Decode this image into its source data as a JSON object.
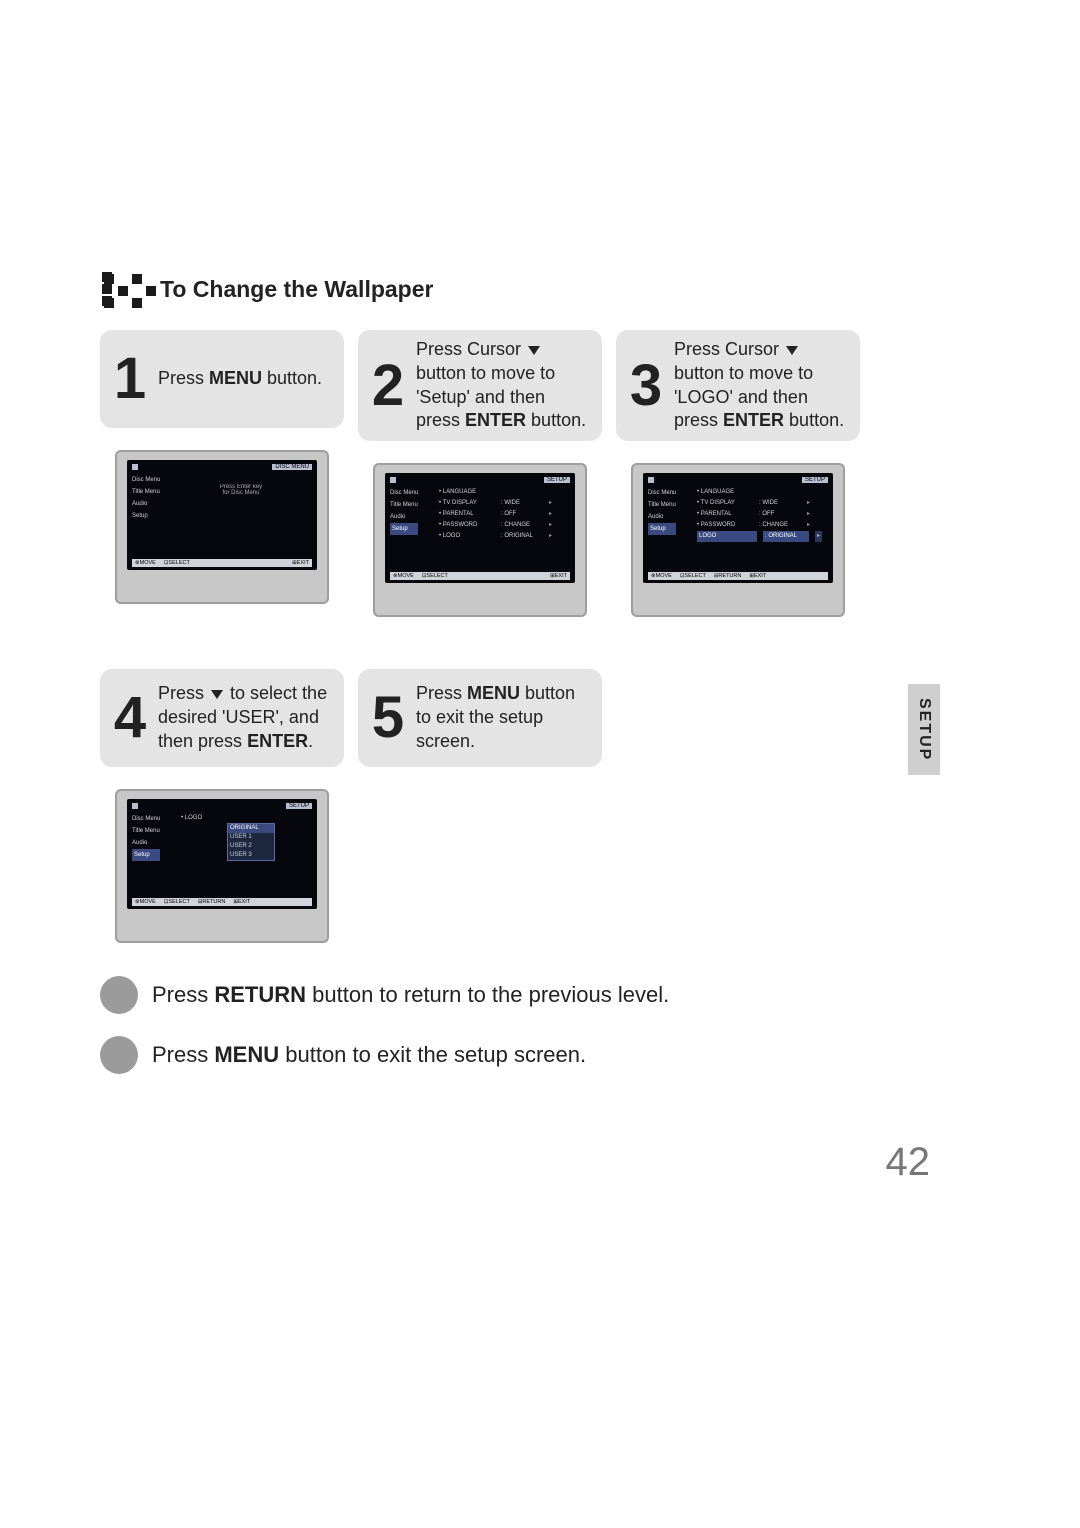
{
  "heading": "To Change the Wallpaper",
  "sideTab": "SETUP",
  "steps": [
    {
      "num": "1",
      "lines": [
        "Press <b>MENU</b> button."
      ]
    },
    {
      "num": "2",
      "lines": [
        "Press Cursor <tri></tri> button to move to 'Setup' and then press <b>ENTER</b> button."
      ]
    },
    {
      "num": "3",
      "lines": [
        "Press Cursor <tri></tri> button to move to 'LOGO' and then press <b>ENTER</b> button."
      ]
    },
    {
      "num": "4",
      "lines": [
        "Press <tri></tri> to select the desired 'USER', and then press <b>ENTER</b>."
      ]
    },
    {
      "num": "5",
      "lines": [
        "Press <b>MENU</b> button to exit the setup screen."
      ]
    }
  ],
  "tv": {
    "sidebar": [
      "Disc Menu",
      "Title Menu",
      "Audio",
      "Setup"
    ],
    "t1": {
      "hdrL": "",
      "hdrR": "DISC MENU",
      "mid1": "Press Enter key",
      "mid2": "for Disc Menu",
      "foot": [
        "⊗MOVE",
        "⊡SELECT",
        "",
        "⊞EXIT"
      ]
    },
    "t2": {
      "hdrL": "",
      "hdrR": "SETUP",
      "rows": [
        [
          "• LANGUAGE",
          "",
          ""
        ],
        [
          "• TV DISPLAY",
          ": WIDE",
          "▸"
        ],
        [
          "• PARENTAL",
          ": OFF",
          "▸"
        ],
        [
          "• PASSWORD",
          ": CHANGE",
          "▸"
        ],
        [
          "• LOGO",
          ": ORIGINAL",
          "▸"
        ]
      ],
      "foot": [
        "⊗MOVE",
        "⊡SELECT",
        "",
        "⊞EXIT"
      ]
    },
    "t3": {
      "hdrL": "",
      "hdrR": "SETUP",
      "rows": [
        [
          "• LANGUAGE",
          "",
          ""
        ],
        [
          "• TV DISPLAY",
          ": WIDE",
          "▸"
        ],
        [
          "• PARENTAL",
          ": OFF",
          "▸"
        ],
        [
          "• PASSWORD",
          ": CHANGE",
          "▸"
        ]
      ],
      "hiRow": [
        "LOGO",
        ": ORIGINAL",
        "▸"
      ],
      "foot": [
        "⊗MOVE",
        "⊡SELECT",
        "⊟RETURN",
        "⊞EXIT"
      ]
    },
    "t4": {
      "hdrL": "",
      "hdrR": "SETUP",
      "rows": [
        [
          "• LOGO",
          "",
          ""
        ]
      ],
      "dd": [
        "ORIGINAL",
        "USER 1",
        "USER 2",
        "USER 3"
      ],
      "foot": [
        "⊗MOVE",
        "⊡SELECT",
        "⊟RETURN",
        "⊞EXIT"
      ]
    }
  },
  "notes": [
    "Press <b>RETURN</b> button to return to the previous level.",
    "Press <b>MENU</b> button to exit the setup screen."
  ],
  "pageNum": "42"
}
